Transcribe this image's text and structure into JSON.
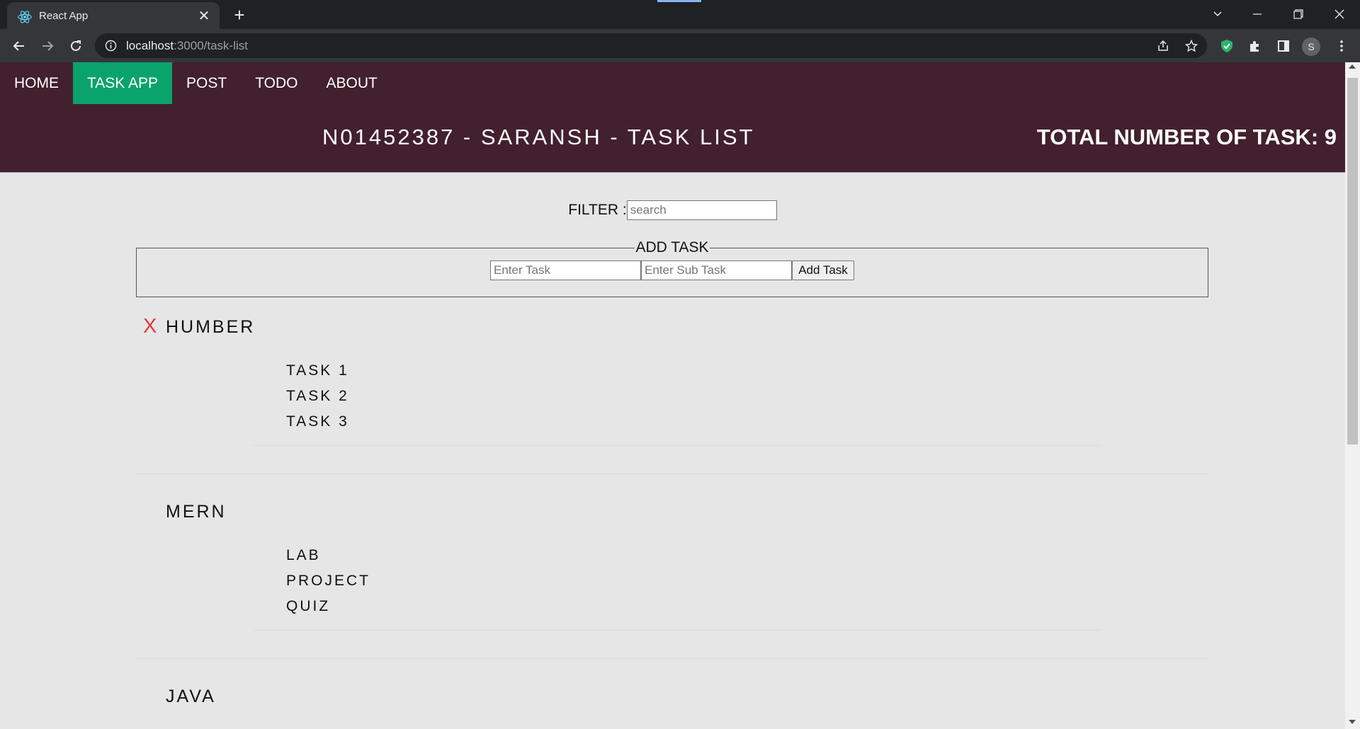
{
  "browser": {
    "tab_title": "React App",
    "url_host": "localhost",
    "url_path": ":3000/task-list",
    "profile_initial": "S",
    "accent_color": "#8ab4f8"
  },
  "nav": {
    "items": [
      {
        "label": "HOME"
      },
      {
        "label": "TASK APP",
        "active": true
      },
      {
        "label": "POST"
      },
      {
        "label": "TODO"
      },
      {
        "label": "ABOUT"
      }
    ],
    "active_color": "#0ba36c",
    "header_color": "#42202d"
  },
  "header": {
    "title": "N01452387 - SARANSH - TASK LIST",
    "total_tasks": "TOTAL NUMBER OF TASK: 9"
  },
  "filter": {
    "label": "FILTER :",
    "placeholder": "search",
    "value": ""
  },
  "add_task": {
    "legend": "ADD TASK",
    "task_placeholder": "Enter Task",
    "subtask_placeholder": "Enter Sub Task",
    "button_label": "Add Task"
  },
  "groups": [
    {
      "name": "HUMBER",
      "delete_label": "X",
      "subtasks": [
        "TASK 1",
        "TASK 2",
        "TASK 3"
      ]
    },
    {
      "name": "MERN",
      "subtasks": [
        "LAB",
        "PROJECT",
        "QUIZ"
      ]
    },
    {
      "name": "JAVA",
      "subtasks": []
    }
  ],
  "icons": {
    "favicon": "react-logo-icon",
    "back": "arrow-left-icon",
    "forward": "arrow-right-icon",
    "reload": "reload-icon",
    "info": "info-icon",
    "share": "share-icon",
    "bookmark": "star-icon",
    "shield": "shield-icon",
    "extensions": "puzzle-icon",
    "sidepanel": "side-panel-icon",
    "menu": "kebab-menu-icon",
    "delete": "delete-x-icon"
  }
}
